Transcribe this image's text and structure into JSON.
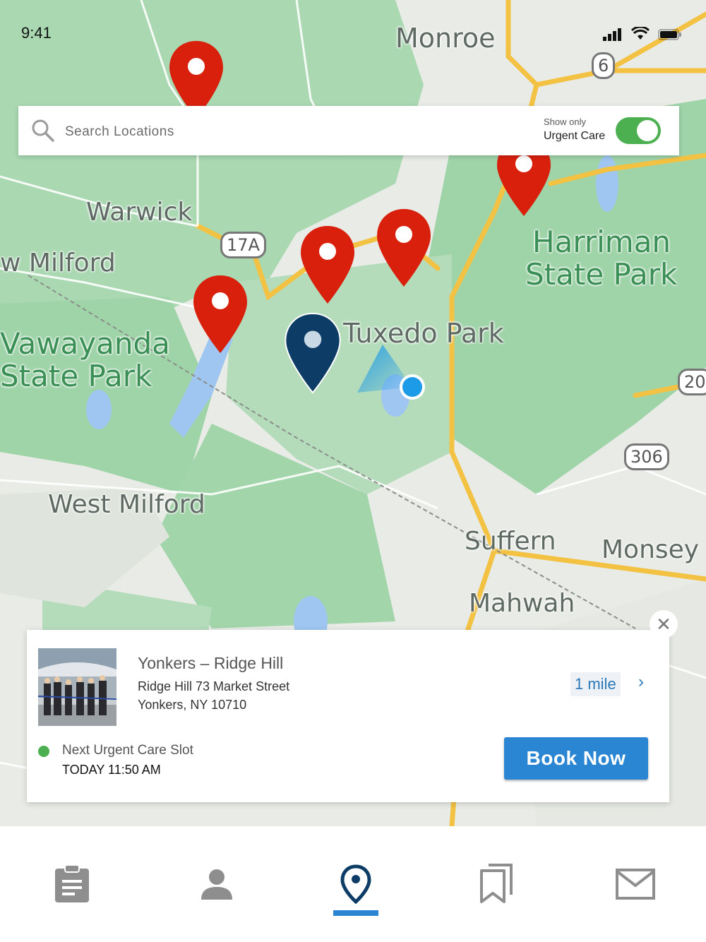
{
  "status_bar": {
    "time": "9:41"
  },
  "map": {
    "labels": {
      "monroe": "Monroe",
      "warwick": "Warwick",
      "new_milford": "w Milford",
      "wawayanda": "Vawayanda",
      "wawayanda_sp": "State Park",
      "harriman": "Harriman",
      "harriman_sp": "State Park",
      "tuxedo_park": "Tuxedo Park",
      "west_milford": "West Milford",
      "suffern": "Suffern",
      "monsey": "Monsey",
      "mahwah": "Mahwah"
    },
    "shields": {
      "r6": "6",
      "r17a": "17A",
      "r306": "306",
      "r20": "20"
    },
    "colors": {
      "pin_red": "#d9200d",
      "pin_selected": "#0d3d66",
      "user_dot": "#1e9be6"
    }
  },
  "search": {
    "placeholder": "Search Locations",
    "value": ""
  },
  "filter": {
    "small_label": "Show only",
    "label": "Urgent Care",
    "enabled": true
  },
  "card": {
    "name": "Yonkers – Ridge Hill",
    "address_line1": "Ridge Hill 73 Market Street",
    "address_line2": "Yonkers, NY 10710",
    "distance": "1 mile",
    "slot_label": "Next Urgent Care Slot",
    "slot_time": "TODAY 11:50 AM",
    "book_label": "Book Now",
    "close_glyph": "✕",
    "chevron_glyph": "›"
  },
  "tabs": [
    {
      "icon": "clipboard-icon",
      "active": false
    },
    {
      "icon": "person-icon",
      "active": false
    },
    {
      "icon": "location-pin-icon",
      "active": true
    },
    {
      "icon": "bookmarks-icon",
      "active": false
    },
    {
      "icon": "mail-icon",
      "active": false
    }
  ],
  "accent_color": "#2a86d3"
}
